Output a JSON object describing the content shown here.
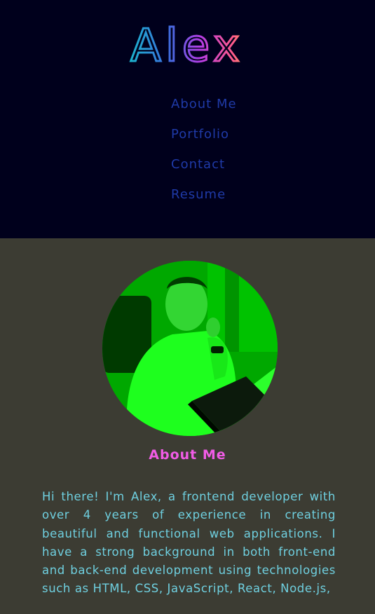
{
  "header": {
    "logo_text": "Alex",
    "colors": {
      "background": "#00001c",
      "nav_link": "#1f3aa8",
      "logo_gradient": [
        "#16c1c9",
        "#3b6ee0",
        "#b43ce4",
        "#ff5a8a",
        "#ffb24a"
      ]
    }
  },
  "nav": {
    "items": [
      {
        "label": "About Me"
      },
      {
        "label": "Portfolio"
      },
      {
        "label": "Contact"
      },
      {
        "label": "Resume"
      }
    ]
  },
  "about": {
    "profile_photo": "profile-photo",
    "title": "About Me",
    "bio": "Hi there! I'm Alex, a frontend developer with over 4 years of experience in creating beautiful and functional web applications. I have a strong background in both front-end and back-end development using technologies such as HTML, CSS, JavaScript, React, Node.js,",
    "colors": {
      "background": "#3c3c33",
      "title": "#f15ce6",
      "bio_text": "#6fd0e0",
      "photo_tint": "#00b800"
    }
  }
}
